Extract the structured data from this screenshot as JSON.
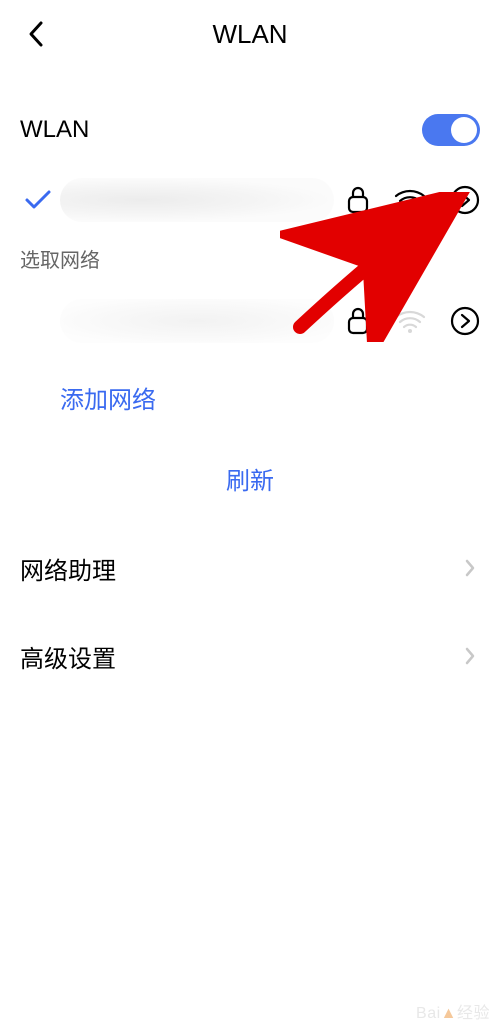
{
  "header": {
    "title": "WLAN"
  },
  "wlan": {
    "label": "WLAN",
    "enabled": true
  },
  "connected_network": {
    "ssid_hidden": true
  },
  "section_label": "选取网络",
  "available_network": {
    "ssid_hidden": true
  },
  "add_network_label": "添加网络",
  "refresh_label": "刷新",
  "menu": {
    "assistant": "网络助理",
    "advanced": "高级设置"
  },
  "watermark": {
    "brand_a": "Bai",
    "brand_b": "经验"
  }
}
